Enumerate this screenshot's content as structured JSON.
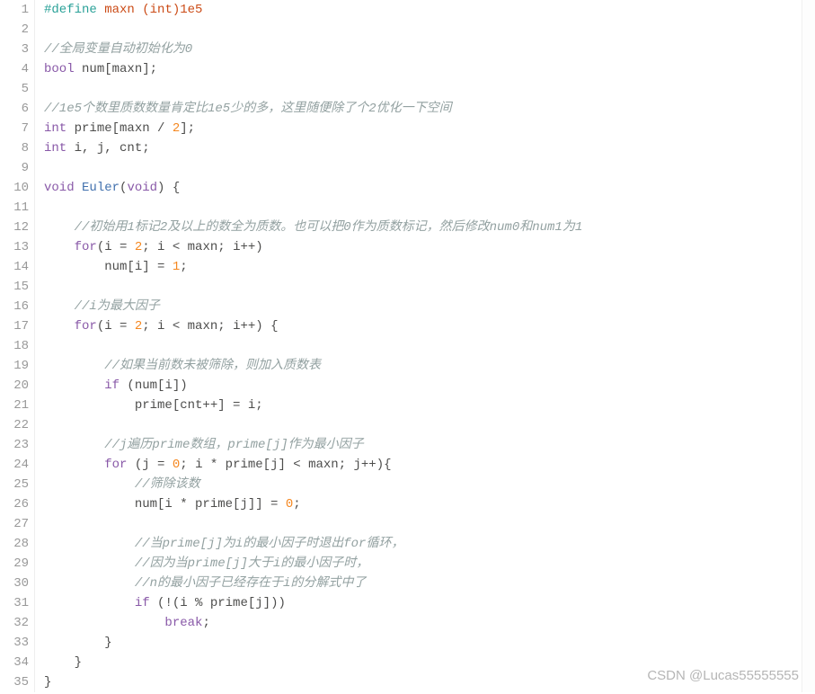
{
  "watermark": "CSDN @Lucas55555555",
  "lines": [
    {
      "n": "1",
      "tokens": [
        [
          "s-pre",
          "#define "
        ],
        [
          "s-macro",
          "maxn "
        ],
        [
          "s-cast",
          "(int)1e5"
        ]
      ]
    },
    {
      "n": "2",
      "tokens": []
    },
    {
      "n": "3",
      "tokens": [
        [
          "s-cmt",
          "//全局变量自动初始化为0"
        ]
      ]
    },
    {
      "n": "4",
      "tokens": [
        [
          "s-type",
          "bool "
        ],
        [
          "s-id",
          "num[maxn];"
        ]
      ]
    },
    {
      "n": "5",
      "tokens": []
    },
    {
      "n": "6",
      "tokens": [
        [
          "s-cmt",
          "//1e5个数里质数数量肯定比1e5少的多，这里随便除了个2优化一下空间"
        ]
      ]
    },
    {
      "n": "7",
      "tokens": [
        [
          "s-type",
          "int "
        ],
        [
          "s-id",
          "prime[maxn / "
        ],
        [
          "s-num",
          "2"
        ],
        [
          "s-id",
          "];"
        ]
      ]
    },
    {
      "n": "8",
      "tokens": [
        [
          "s-type",
          "int "
        ],
        [
          "s-id",
          "i, j, cnt;"
        ]
      ]
    },
    {
      "n": "9",
      "tokens": []
    },
    {
      "n": "10",
      "tokens": [
        [
          "s-type",
          "void "
        ],
        [
          "s-fn",
          "Euler"
        ],
        [
          "s-id",
          "("
        ],
        [
          "s-type",
          "void"
        ],
        [
          "s-id",
          ") {"
        ]
      ]
    },
    {
      "n": "11",
      "tokens": []
    },
    {
      "n": "12",
      "tokens": [
        [
          "s-id",
          "    "
        ],
        [
          "s-cmt",
          "//初始用1标记2及以上的数全为质数。也可以把0作为质数标记，然后修改num0和num1为1"
        ]
      ]
    },
    {
      "n": "13",
      "tokens": [
        [
          "s-id",
          "    "
        ],
        [
          "s-kw",
          "for"
        ],
        [
          "s-id",
          "(i = "
        ],
        [
          "s-num",
          "2"
        ],
        [
          "s-id",
          "; i < maxn; i++)"
        ]
      ]
    },
    {
      "n": "14",
      "tokens": [
        [
          "s-id",
          "        num[i] = "
        ],
        [
          "s-num",
          "1"
        ],
        [
          "s-id",
          ";"
        ]
      ]
    },
    {
      "n": "15",
      "tokens": []
    },
    {
      "n": "16",
      "tokens": [
        [
          "s-id",
          "    "
        ],
        [
          "s-cmt",
          "//i为最大因子"
        ]
      ]
    },
    {
      "n": "17",
      "tokens": [
        [
          "s-id",
          "    "
        ],
        [
          "s-kw",
          "for"
        ],
        [
          "s-id",
          "(i = "
        ],
        [
          "s-num",
          "2"
        ],
        [
          "s-id",
          "; i < maxn; i++) {"
        ]
      ]
    },
    {
      "n": "18",
      "tokens": []
    },
    {
      "n": "19",
      "tokens": [
        [
          "s-id",
          "        "
        ],
        [
          "s-cmt",
          "//如果当前数未被筛除，则加入质数表"
        ]
      ]
    },
    {
      "n": "20",
      "tokens": [
        [
          "s-id",
          "        "
        ],
        [
          "s-kw",
          "if"
        ],
        [
          "s-id",
          " (num[i])"
        ]
      ]
    },
    {
      "n": "21",
      "tokens": [
        [
          "s-id",
          "            prime[cnt++] = i;"
        ]
      ]
    },
    {
      "n": "22",
      "tokens": []
    },
    {
      "n": "23",
      "tokens": [
        [
          "s-id",
          "        "
        ],
        [
          "s-cmt",
          "//j遍历prime数组，prime[j]作为最小因子"
        ]
      ]
    },
    {
      "n": "24",
      "tokens": [
        [
          "s-id",
          "        "
        ],
        [
          "s-kw",
          "for"
        ],
        [
          "s-id",
          " (j = "
        ],
        [
          "s-num",
          "0"
        ],
        [
          "s-id",
          "; i * prime[j] < maxn; j++){"
        ]
      ]
    },
    {
      "n": "25",
      "tokens": [
        [
          "s-id",
          "            "
        ],
        [
          "s-cmt",
          "//筛除该数"
        ]
      ]
    },
    {
      "n": "26",
      "tokens": [
        [
          "s-id",
          "            num[i * prime[j]] = "
        ],
        [
          "s-num",
          "0"
        ],
        [
          "s-id",
          ";"
        ]
      ]
    },
    {
      "n": "27",
      "tokens": []
    },
    {
      "n": "28",
      "tokens": [
        [
          "s-id",
          "            "
        ],
        [
          "s-cmt",
          "//当prime[j]为i的最小因子时退出for循环，"
        ]
      ]
    },
    {
      "n": "29",
      "tokens": [
        [
          "s-id",
          "            "
        ],
        [
          "s-cmt",
          "//因为当prime[j]大于i的最小因子时，"
        ]
      ]
    },
    {
      "n": "30",
      "tokens": [
        [
          "s-id",
          "            "
        ],
        [
          "s-cmt",
          "//n的最小因子已经存在于i的分解式中了"
        ]
      ]
    },
    {
      "n": "31",
      "tokens": [
        [
          "s-id",
          "            "
        ],
        [
          "s-kw",
          "if"
        ],
        [
          "s-id",
          " (!(i % prime[j]))"
        ]
      ]
    },
    {
      "n": "32",
      "tokens": [
        [
          "s-id",
          "                "
        ],
        [
          "s-kw",
          "break"
        ],
        [
          "s-id",
          ";"
        ]
      ]
    },
    {
      "n": "33",
      "tokens": [
        [
          "s-id",
          "        }"
        ]
      ]
    },
    {
      "n": "34",
      "tokens": [
        [
          "s-id",
          "    }"
        ]
      ]
    },
    {
      "n": "35",
      "tokens": [
        [
          "s-id",
          "}"
        ]
      ]
    }
  ]
}
